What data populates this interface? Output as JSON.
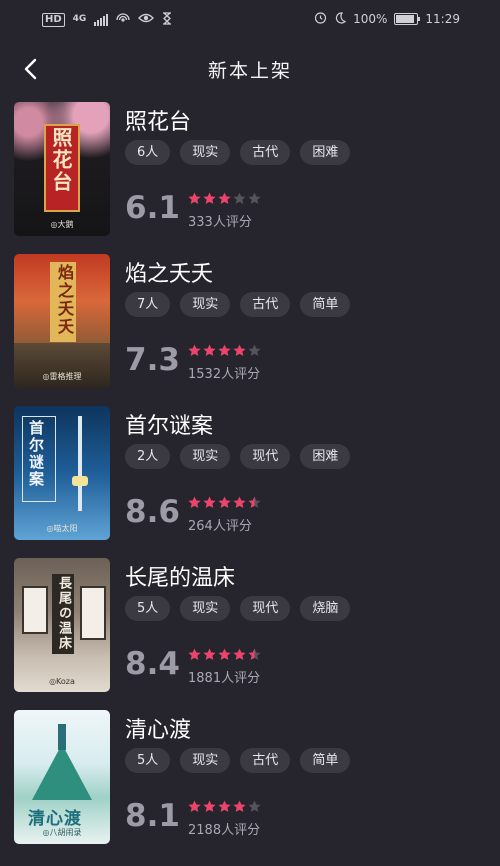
{
  "status_bar": {
    "hd": "HD",
    "network": "4G",
    "battery_percent": "100%",
    "time": "11:29",
    "icons": [
      "hd-icon",
      "signal-icon",
      "hotspot-icon",
      "eye-comfort-icon",
      "hourglass-icon",
      "alarm-icon",
      "moon-icon",
      "battery-icon"
    ]
  },
  "nav": {
    "title": "新本上架",
    "back_icon": "chevron-left-icon"
  },
  "items": [
    {
      "title": "照花台",
      "tags": [
        "6人",
        "现实",
        "古代",
        "困难"
      ],
      "score": "6.1",
      "stars": 3,
      "rating_count": "333人评分",
      "cover": {
        "text": "照花台",
        "footer": "◎大鹅",
        "palette": [
          "#1a1a1d",
          "#c12a2a",
          "#e3a2b9"
        ]
      }
    },
    {
      "title": "焰之夭夭",
      "tags": [
        "7人",
        "现实",
        "古代",
        "简单"
      ],
      "score": "7.3",
      "stars": 4,
      "rating_count": "1532人评分",
      "cover": {
        "text": "焰之夭夭",
        "footer": "◎雷格推理",
        "palette": [
          "#c4391d",
          "#e3843a",
          "#6a4a2a"
        ]
      }
    },
    {
      "title": "首尔谜案",
      "tags": [
        "2人",
        "现实",
        "现代",
        "困难"
      ],
      "score": "8.6",
      "stars": 4.5,
      "rating_count": "264人评分",
      "cover": {
        "text": "首尔谜案",
        "footer": "◎喵太阳",
        "palette": [
          "#0f3b66",
          "#2f76b5",
          "#8ac2ea"
        ]
      }
    },
    {
      "title": "长尾的温床",
      "tags": [
        "5人",
        "现实",
        "现代",
        "烧脑"
      ],
      "score": "8.4",
      "stars": 4.5,
      "rating_count": "1881人评分",
      "cover": {
        "text": "長尾の温床",
        "footer": "◎Koza",
        "palette": [
          "#5a5048",
          "#9c8f80",
          "#dcd3c6"
        ]
      }
    },
    {
      "title": "清心渡",
      "tags": [
        "5人",
        "现实",
        "古代",
        "简单"
      ],
      "score": "8.1",
      "stars": 4,
      "rating_count": "2188人评分",
      "cover": {
        "text": "清心渡",
        "footer": "◎八胡闹录",
        "palette": [
          "#e8f3f6",
          "#3f9a8c",
          "#1e6a73"
        ]
      }
    }
  ],
  "colors": {
    "background": "#26242d",
    "tag_bg": "#3b3a43",
    "star_on": "#f0446b",
    "star_off": "#55545d",
    "score": "#9c9ba6"
  }
}
